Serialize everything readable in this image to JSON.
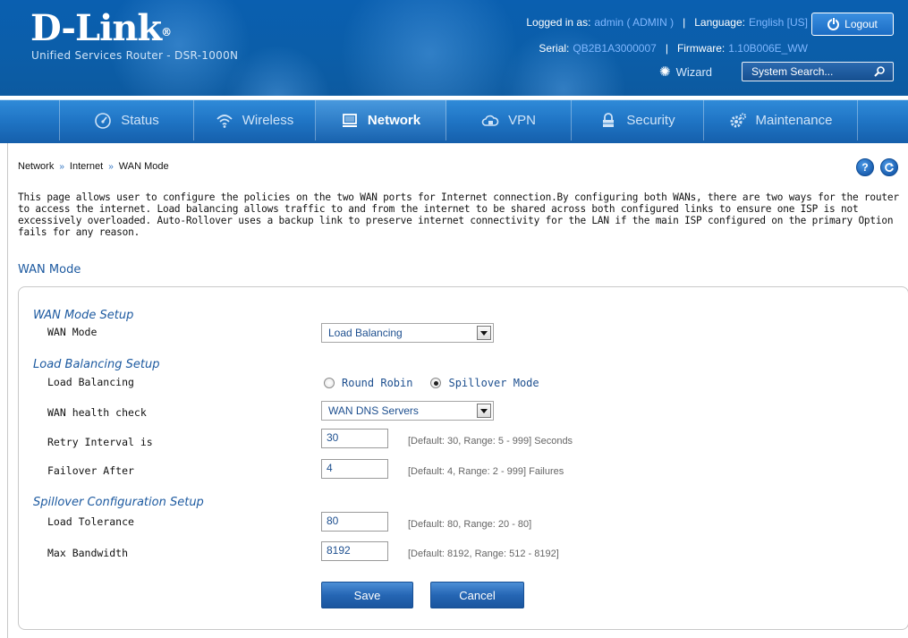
{
  "header": {
    "logo": "D-Link",
    "logo_mark": "®",
    "product": "Unified Services Router - DSR-1000N",
    "logged_in_label": "Logged in as:",
    "logged_in_value": "admin ( ADMIN )",
    "separator": "|",
    "language_label": "Language:",
    "language_value": "English [US]",
    "serial_label": "Serial:",
    "serial_value": "QB2B1A3000007",
    "firmware_label": "Firmware:",
    "firmware_value": "1.10B006E_WW",
    "logout_label": "Logout",
    "wizard_label": "Wizard",
    "search_placeholder": "System Search..."
  },
  "nav": {
    "items": [
      {
        "label": "Status",
        "icon": "gauge-icon",
        "active": false
      },
      {
        "label": "Wireless",
        "icon": "wifi-icon",
        "active": false
      },
      {
        "label": "Network",
        "icon": "monitor-icon",
        "active": true
      },
      {
        "label": "VPN",
        "icon": "cloud-lock-icon",
        "active": false
      },
      {
        "label": "Security",
        "icon": "lock-icon",
        "active": false
      },
      {
        "label": "Maintenance",
        "icon": "gears-icon",
        "active": false
      }
    ]
  },
  "breadcrumb": {
    "items": [
      "Network",
      "Internet",
      "WAN Mode"
    ],
    "sep": "»"
  },
  "help": {
    "help_symbol": "?"
  },
  "description": "This page allows user to configure the policies on the two WAN ports for Internet connection.By configuring both WANs, there are two ways for the router to access the internet. Load balancing allows traffic to and from the internet to be shared across both configured links to ensure one ISP is not excessively overloaded. Auto-Rollover uses a backup link to preserve internet connectivity for the LAN if the main ISP configured on the primary Option fails for any reason.",
  "page_title": "WAN Mode",
  "form": {
    "wan_mode_setup": "WAN Mode Setup",
    "wan_mode_label": "WAN Mode",
    "wan_mode_value": "Load Balancing",
    "lb_setup": "Load Balancing Setup",
    "lb_label": "Load Balancing",
    "lb_opt1": "Round Robin",
    "lb_opt2": "Spillover Mode",
    "lb_selected": "Spillover Mode",
    "health_label": "WAN health check",
    "health_value": "WAN DNS Servers",
    "retry_label": "Retry Interval is",
    "retry_value": "30",
    "retry_hint": "[Default: 30, Range: 5 - 999] Seconds",
    "failover_label": "Failover After",
    "failover_value": "4",
    "failover_hint": "[Default: 4, Range: 2 - 999] Failures",
    "spill_setup": "Spillover Configuration Setup",
    "tolerance_label": "Load Tolerance",
    "tolerance_value": "80",
    "tolerance_hint": "[Default: 80, Range: 20 - 80]",
    "bandwidth_label": "Max Bandwidth",
    "bandwidth_value": "8192",
    "bandwidth_hint": "[Default: 8192, Range: 512 - 8192]",
    "save": "Save",
    "cancel": "Cancel"
  },
  "colors": {
    "header_blue": "#0b5ea9",
    "accent_text": "#1d5aa0",
    "link_value": "#7fb7ff"
  }
}
